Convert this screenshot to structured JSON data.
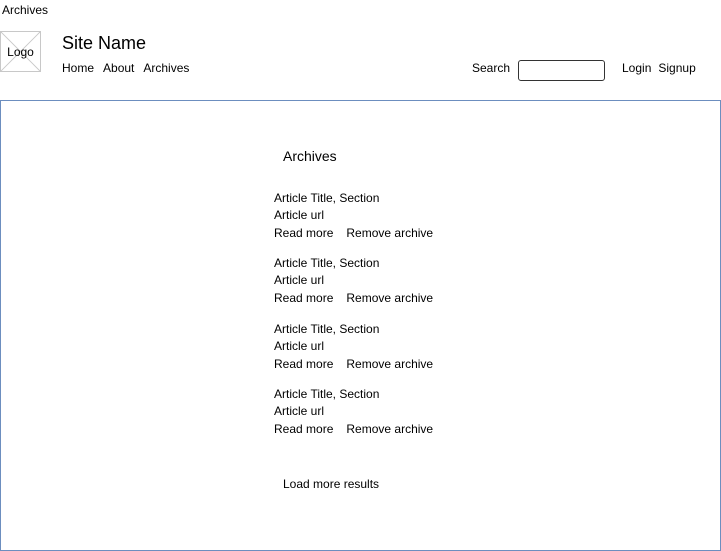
{
  "page_label": "Archives",
  "header": {
    "logo_text": "Logo",
    "site_name": "Site Name",
    "nav": [
      "Home",
      "About",
      "Archives"
    ],
    "search_label": "Search",
    "search_value": "",
    "auth": {
      "login": "Login",
      "signup": "Signup"
    }
  },
  "main": {
    "title": "Archives",
    "items": [
      {
        "title": "Article Title, Section",
        "url": "Article url",
        "read_more": "Read more",
        "remove": "Remove archive"
      },
      {
        "title": "Article Title, Section",
        "url": "Article url",
        "read_more": "Read more",
        "remove": "Remove archive"
      },
      {
        "title": "Article Title, Section",
        "url": "Article url",
        "read_more": "Read more",
        "remove": "Remove archive"
      },
      {
        "title": "Article Title, Section",
        "url": "Article url",
        "read_more": "Read more",
        "remove": "Remove archive"
      }
    ],
    "load_more": "Load more results"
  },
  "colors": {
    "content_border": "#6c8ebf",
    "logo_border": "#c8c8c8"
  }
}
